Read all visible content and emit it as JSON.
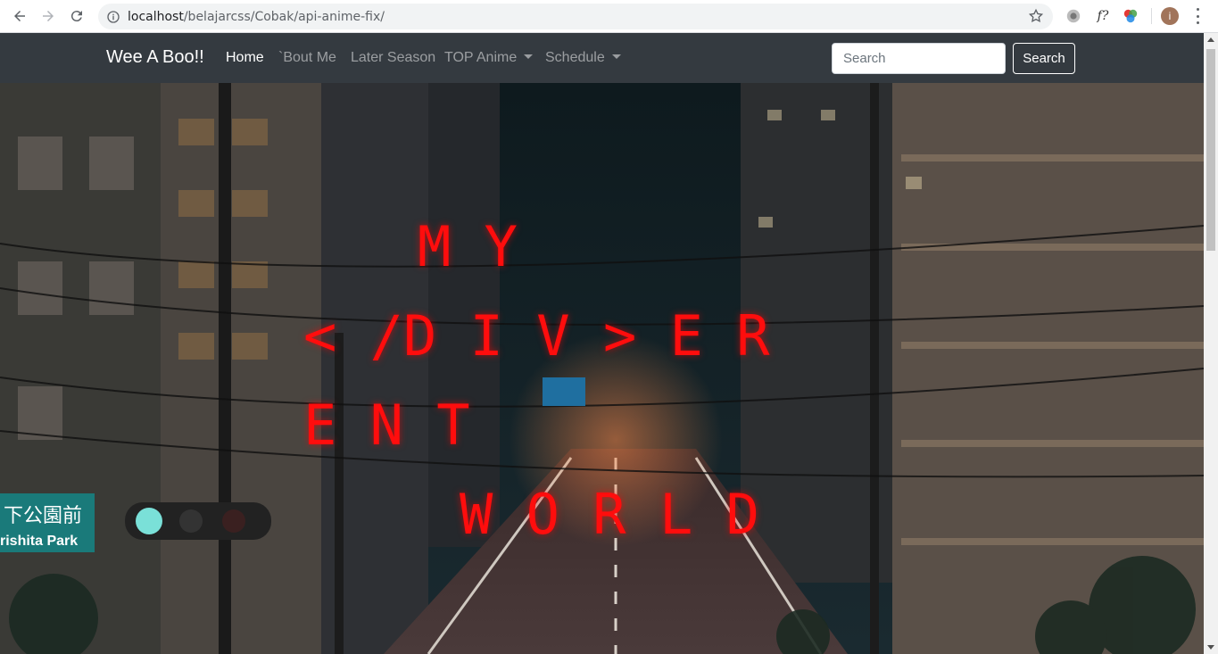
{
  "browser": {
    "url_host": "localhost",
    "url_path": "/belajarcss/Cobak/api-anime-fix/",
    "avatar_letter": "i",
    "extension_label": "f?"
  },
  "navbar": {
    "brand": "Wee A Boo!!",
    "links": [
      {
        "label": "Home",
        "active": true
      },
      {
        "label": "`Bout Me"
      },
      {
        "label": "Later Season"
      },
      {
        "label": "TOP Anime",
        "dropdown": true
      },
      {
        "label": "Schedule",
        "dropdown": true
      }
    ],
    "search": {
      "placeholder": "Search",
      "button": "Search"
    }
  },
  "hero": {
    "lines": [
      "M Y",
      "< /D I V > E R",
      "E N T",
      "W O R L D"
    ],
    "text_color": "#ff0d0d",
    "sign_text_1": "下公園前",
    "sign_text_2": "rishita Park"
  },
  "colors": {
    "navbar_bg": "#343a40",
    "neon": "#ff0d0d"
  }
}
